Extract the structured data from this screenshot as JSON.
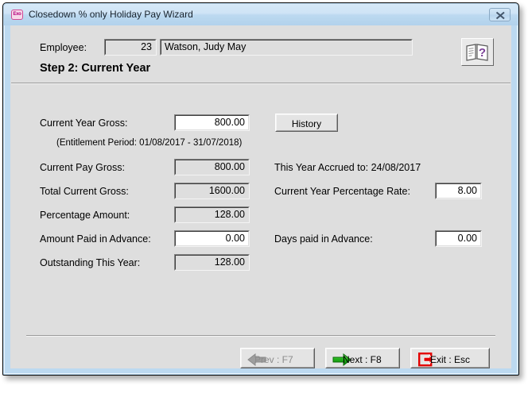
{
  "window": {
    "title": "Closedown % only Holiday Pay Wizard",
    "app_icon": "exo-app-icon",
    "app_icon_text": "Exo",
    "close_label": "Close",
    "frame_color": "#bcd9f0",
    "client_color": "#dedede"
  },
  "header": {
    "employee_label": "Employee:",
    "employee_code": "23",
    "employee_name": "Watson, Judy May",
    "step_heading": "Step 2:  Current Year",
    "help_icon": "help-book-icon"
  },
  "left_column": {
    "fields": [
      {
        "label": "Current Year Gross:",
        "value": "800.00",
        "editable": true
      },
      {
        "label": "Current Pay Gross:",
        "value": "800.00",
        "editable": false
      },
      {
        "label": "Total Current Gross:",
        "value": "1600.00",
        "editable": false
      },
      {
        "label": "Percentage Amount:",
        "value": "128.00",
        "editable": false
      },
      {
        "label": "Amount Paid in Advance:",
        "value": "0.00",
        "editable": true
      },
      {
        "label": "Outstanding This Year:",
        "value": "128.00",
        "editable": false
      }
    ],
    "entitlement_note": "(Entitlement Period: 01/08/2017 - 31/07/2018)"
  },
  "right_column": {
    "history_button": "History",
    "accrued_label": "This Year Accrued to:",
    "accrued_value": "24/08/2017",
    "accrued_line": "This Year Accrued to:  24/08/2017",
    "rate_label": "Current Year Percentage Rate:",
    "rate_value": "8.00",
    "days_label": "Days paid in Advance:",
    "days_value": "0.00"
  },
  "footer": {
    "prev_label": "Prev : F7",
    "prev_icon": "arrow-left-icon",
    "prev_disabled": true,
    "next_label": "Next : F8",
    "next_icon": "arrow-right-icon",
    "exit_label": "Exit : Esc",
    "exit_icon": "exit-door-icon"
  },
  "colors": {
    "green_arrow": "#17a513",
    "red_exit": "#e30000",
    "gray_arrow": "#9a9a9a",
    "purple_question": "#7b3f98"
  }
}
